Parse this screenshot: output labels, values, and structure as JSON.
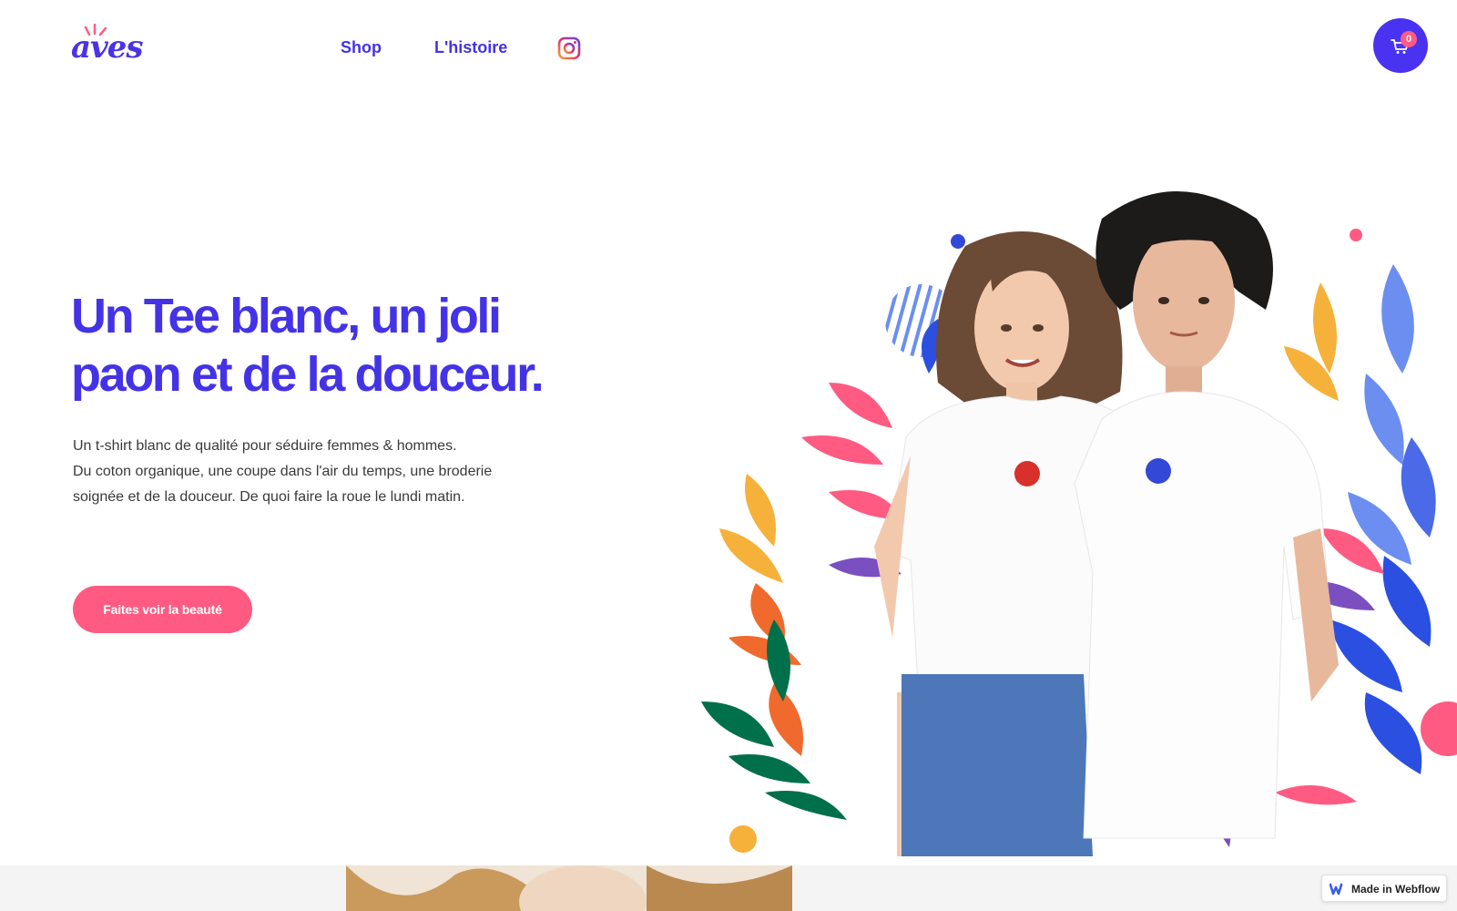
{
  "brand": {
    "logo_text": "aves",
    "primary_color": "#4433e6",
    "accent_color": "#ff5b82"
  },
  "nav": {
    "items": [
      {
        "label": "Shop"
      },
      {
        "label": "L'histoire"
      }
    ],
    "instagram_icon": "instagram-icon"
  },
  "cart": {
    "icon": "cart-icon",
    "count": "0"
  },
  "hero": {
    "title_line1": "Un Tee blanc, un joli",
    "title_line2": "paon et de la douceur.",
    "desc_line1": "Un t-shirt blanc de qualité pour séduire femmes & hommes.",
    "desc_line2": "Du coton organique, une coupe dans l'air du temps, une broderie",
    "desc_line3": "soignée et de la douceur. De quoi faire la roue le lundi matin.",
    "cta_label": "Faites voir la beauté"
  },
  "badge": {
    "label": "Made in Webflow"
  }
}
